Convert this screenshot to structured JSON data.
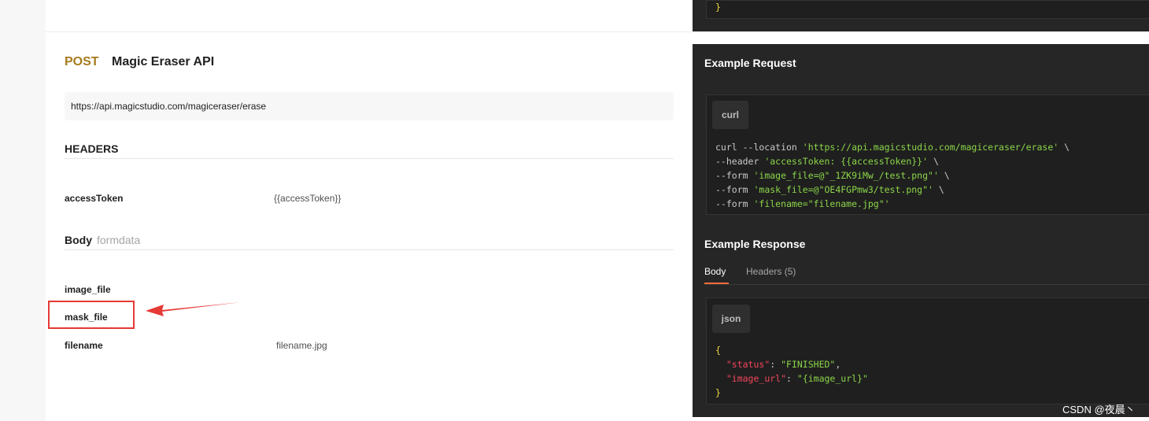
{
  "endpoint": {
    "method": "POST",
    "title": "Magic Eraser API",
    "url": "https://api.magicstudio.com/magiceraser/erase"
  },
  "headers_section": {
    "title": "HEADERS",
    "params": [
      {
        "name": "accessToken",
        "value": "{{accessToken}}"
      }
    ]
  },
  "body_section": {
    "title": "Body",
    "subtitle": "formdata",
    "params": [
      {
        "name": "image_file",
        "value": ""
      },
      {
        "name": "mask_file",
        "value": ""
      },
      {
        "name": "filename",
        "value": "filename.jpg"
      }
    ]
  },
  "top_code": {
    "line": "}"
  },
  "example_request": {
    "title": "Example Request",
    "lang": "curl",
    "lines": [
      {
        "plain": "curl --location ",
        "str": "'https://api.magicstudio.com/magiceraser/erase'",
        "tail": " \\"
      },
      {
        "plain": "--header ",
        "str": "'accessToken: {{accessToken}}'",
        "tail": " \\"
      },
      {
        "plain": "--form ",
        "str": "'image_file=@\"_1ZK9iMw_/test.png\"'",
        "tail": " \\"
      },
      {
        "plain": "--form ",
        "str": "'mask_file=@\"OE4FGPmw3/test.png\"'",
        "tail": " \\"
      },
      {
        "plain": "--form ",
        "str": "'filename=\"filename.jpg\"'",
        "tail": ""
      }
    ]
  },
  "example_response": {
    "title": "Example Response",
    "tabs": [
      "Body",
      "Headers (5)"
    ],
    "lang": "json",
    "open_brace": "{",
    "close_brace": "}",
    "entries": [
      {
        "key": "\"status\"",
        "sep": ": ",
        "value": "\"FINISHED\"",
        "comma": ","
      },
      {
        "key": "\"image_url\"",
        "sep": ": ",
        "value": "\"{image_url}\"",
        "comma": ""
      }
    ]
  },
  "watermark": "CSDN @夜晨丶",
  "colors": {
    "method": "#a57c1b",
    "annotation": "#e53935",
    "code_string": "#8bd649",
    "code_key": "#f4465b",
    "tab_accent": "#f26b3a"
  }
}
